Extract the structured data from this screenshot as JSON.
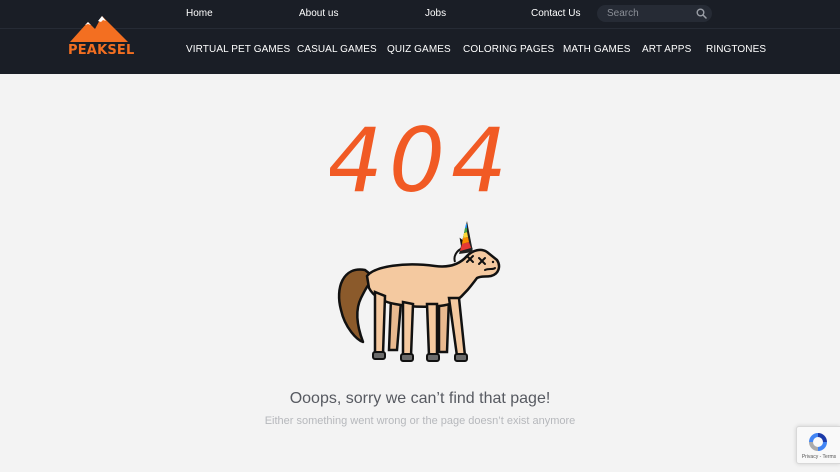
{
  "brand": {
    "logo_text": "PEAKSEL"
  },
  "top_links": [
    "Home",
    "About us",
    "Jobs",
    "Contact Us"
  ],
  "search": {
    "placeholder": "Search"
  },
  "nav": [
    "VIRTUAL PET GAMES",
    "CASUAL GAMES",
    "QUIZ GAMES",
    "COLORING PAGES",
    "MATH GAMES",
    "ART APPS",
    "RINGTONES"
  ],
  "error": {
    "code": "404",
    "message": "Ooops, sorry we can’t find that page!",
    "submessage": "Either something went wrong or the page doesn’t exist anymore"
  },
  "recaptcha": {
    "footer": "Privacy - Terms"
  },
  "colors": {
    "header_bg": "#1a1e26",
    "brand_orange": "#f36f21",
    "page_bg": "#f3f3f3"
  },
  "icons": {
    "search": "search-icon",
    "logo": "mountain-logo-icon",
    "illustration": "dead-unicorn-illustration"
  }
}
